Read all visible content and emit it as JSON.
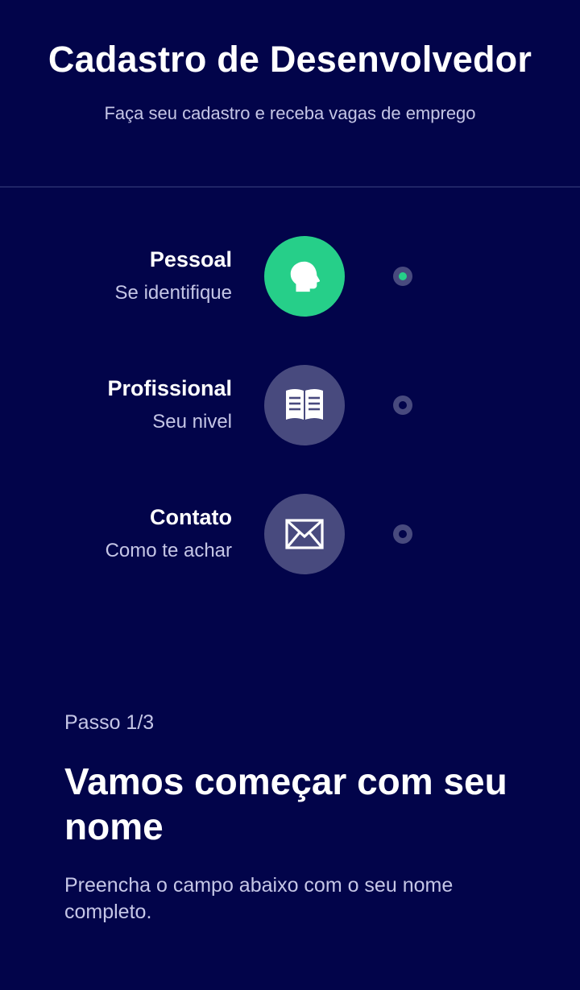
{
  "header": {
    "title": "Cadastro de Desenvolvedor",
    "subtitle": "Faça seu cadastro e receba vagas de emprego"
  },
  "steps": [
    {
      "title": "Pessoal",
      "subtitle": "Se identifique",
      "icon": "head-silhouette-icon",
      "active": true
    },
    {
      "title": "Profissional",
      "subtitle": "Seu nivel",
      "icon": "book-icon",
      "active": false
    },
    {
      "title": "Contato",
      "subtitle": "Como te achar",
      "icon": "envelope-icon",
      "active": false
    }
  ],
  "colors": {
    "background": "#02044a",
    "accent": "#26cf89",
    "inactive": "#484a7e",
    "muted_text": "#c5c6e6"
  },
  "main": {
    "step_counter": "Passo 1/3",
    "title": "Vamos começar com seu nome",
    "description": "Preencha o campo abaixo com o seu nome completo."
  }
}
